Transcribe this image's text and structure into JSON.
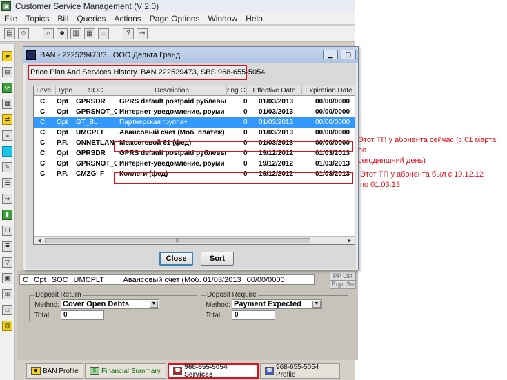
{
  "app": {
    "title": "Customer Service Management  (V 2.0)",
    "menu": [
      "File",
      "Topics",
      "Bill",
      "Queries",
      "Actions",
      "Page Options",
      "Window",
      "Help"
    ]
  },
  "dialog": {
    "title": "BAN - 222529473/3 , ООО Дельта Гранд",
    "history_label": "Price Plan And Services History. BAN 222529473, SBS 968-655-5054.",
    "columns": [
      "Level",
      "Type",
      "SOC",
      "Description",
      "ring Ch",
      "Effective Date",
      "Expiration Date"
    ],
    "rows": [
      {
        "level": "C",
        "type": "Opt",
        "soc": "GPRSDR",
        "desc": "GPRS default postpaid рублевы",
        "ch": "0",
        "eff": "01/03/2013",
        "exp": "00/00/0000"
      },
      {
        "level": "C",
        "type": "Opt",
        "soc": "GPRSNOT_C",
        "desc": "Интернет-уведомление, роуми",
        "ch": "0",
        "eff": "01/03/2013",
        "exp": "00/00/0000"
      },
      {
        "level": "C",
        "type": "Opt",
        "soc": "GT_BL",
        "desc": "Партнерская группа+",
        "ch": "0",
        "eff": "01/03/2013",
        "exp": "00/00/0000"
      },
      {
        "level": "C",
        "type": "Opt",
        "soc": "UMCPLT",
        "desc": "Авансовый счет (Моб. платеж)",
        "ch": "0",
        "eff": "01/03/2013",
        "exp": "00/00/0000"
      },
      {
        "level": "C",
        "type": "P.P.",
        "soc": "ONNETLAN",
        "desc": "Межсетевой 61 (фед)",
        "ch": "0",
        "eff": "01/03/2013",
        "exp": "00/00/0000"
      },
      {
        "level": "C",
        "type": "Opt",
        "soc": "GPRSDR",
        "desc": "GPRS default postpaid рублевы",
        "ch": "0",
        "eff": "19/12/2012",
        "exp": "01/03/2013"
      },
      {
        "level": "C",
        "type": "Opt",
        "soc": "GPRSNOT_C",
        "desc": "Интернет-уведомление, роуми",
        "ch": "0",
        "eff": "19/12/2012",
        "exp": "01/03/2013"
      },
      {
        "level": "C",
        "type": "P.P.",
        "soc": "CMZG_F",
        "desc": "Коллеги (фед)",
        "ch": "0",
        "eff": "19/12/2012",
        "exp": "01/03/2013"
      }
    ],
    "close_label": "Close",
    "sort_label": "Sort"
  },
  "background": {
    "row": {
      "level": "C",
      "type": "Opt",
      "col": "SOC",
      "soc": "UMCPLT",
      "desc": "Авансовый счет (Моб. пл",
      "eff": "01/03/2013",
      "exp": "00/00/0000"
    },
    "side_btn1": "PP List",
    "side_btn2": "Eqp. So",
    "deposit_return": {
      "title": "Deposit Return",
      "method_label": "Method:",
      "method_value": "Cover Open Debts",
      "total_label": "Total:",
      "total_value": "0"
    },
    "deposit_require": {
      "title": "Deposit Require",
      "method_label": "Method:",
      "method_value": "Payment Expected",
      "total_label": "Total:",
      "total_value": "0"
    }
  },
  "tabs": [
    {
      "label": "BAN Profile"
    },
    {
      "label": "Financial Summary"
    },
    {
      "label": "968-655-5054 Services"
    },
    {
      "label": "968-655-5054 Profile"
    }
  ],
  "annotations": {
    "current": "Этот ТП у абонента сейчас (с 01 марта по сегодняшний день)",
    "current_line1": "Этот ТП у абонента сейчас (с 01 марта по",
    "current_line2": "сегодняшний день)",
    "previous_line1": "Этот ТП у абонента был с 19.12.12",
    "previous_line2": "по 01.03.13"
  },
  "colors": {
    "highlight": "#e0101a",
    "selection": "#3399ff"
  }
}
